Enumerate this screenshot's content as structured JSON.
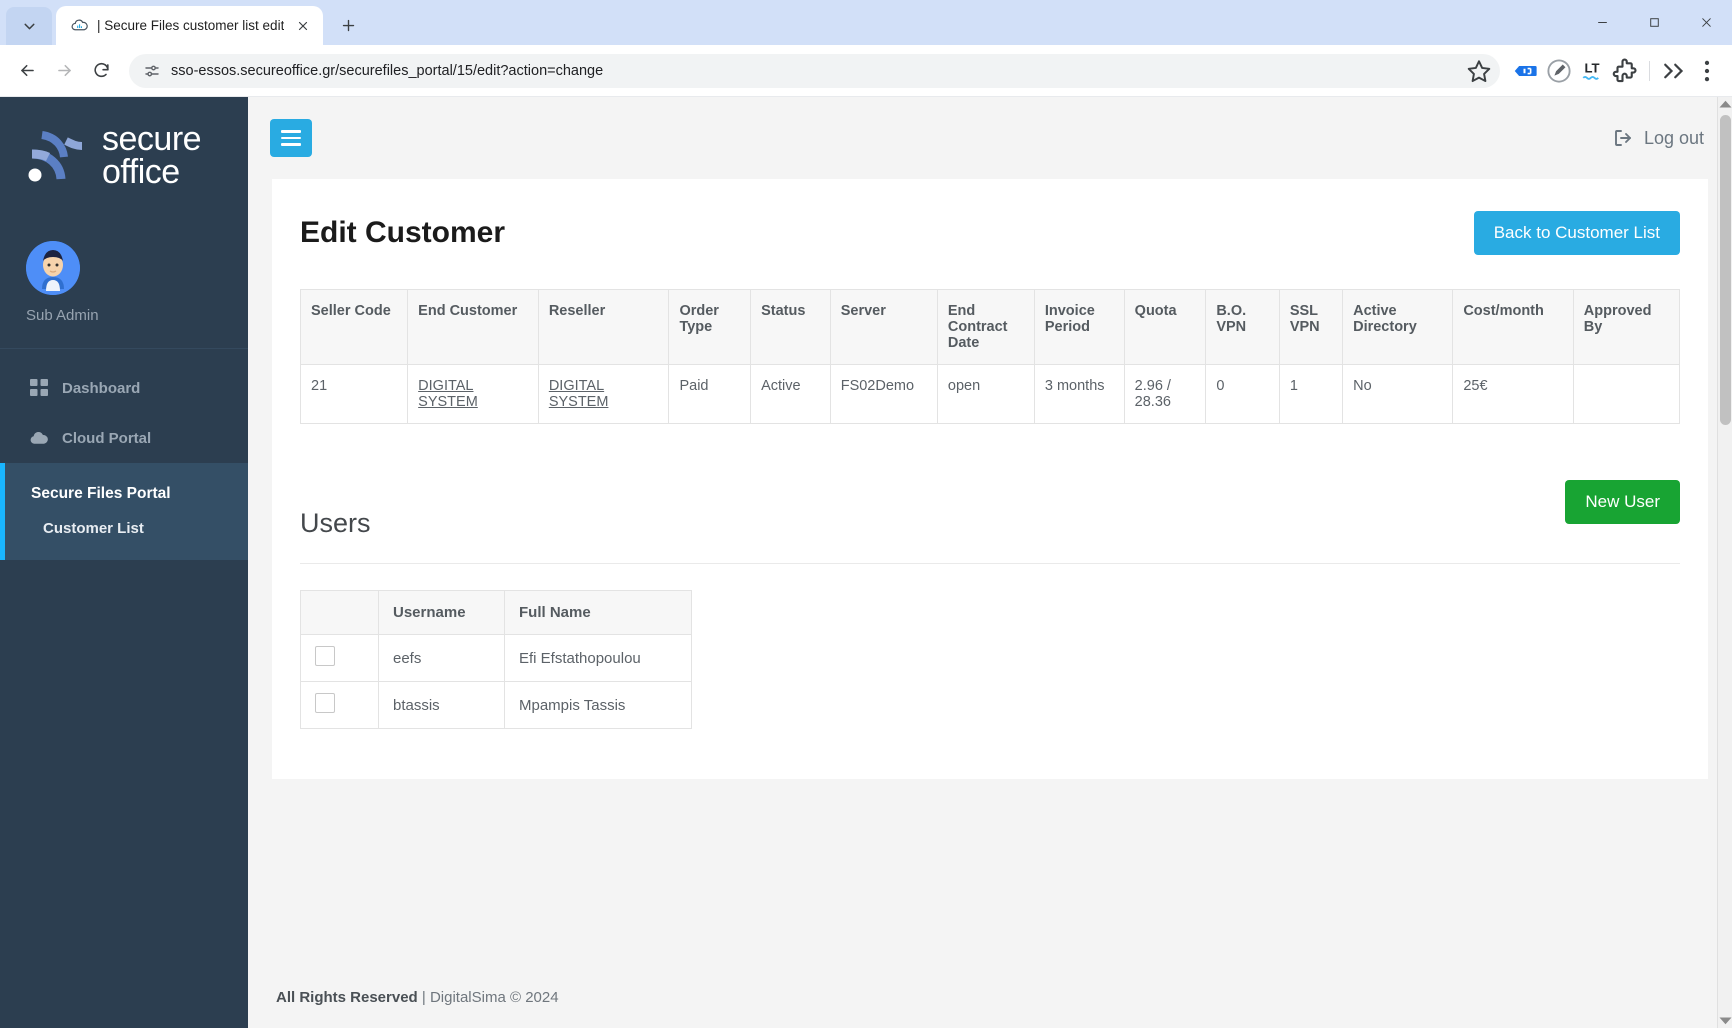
{
  "browser": {
    "tab": {
      "title": "| Secure Files customer list edit",
      "favicon": "cloud-chart-icon"
    },
    "new_tab_label": "+",
    "url": "sso-essos.secureoffice.gr/securefiles_portal/15/edit?action=change",
    "window_controls": [
      "minimize",
      "maximize",
      "close"
    ],
    "toolbar_icons": [
      "back-arrow",
      "forward-arrow",
      "reload",
      "site-info",
      "bookmark-star",
      "reading-list",
      "edit-pencil",
      "languagetool",
      "extensions-puzzle",
      "profile",
      "chrome-menu"
    ]
  },
  "sidebar": {
    "brand": {
      "line1": "secure",
      "line2": "office"
    },
    "user": {
      "name": "Sub Admin",
      "avatar": "user-avatar"
    },
    "items": [
      {
        "label": "Dashboard",
        "icon": "grid-icon"
      },
      {
        "label": "Cloud Portal",
        "icon": "cloud-icon"
      }
    ],
    "active_section": {
      "title": "Secure Files Portal",
      "sub": "Customer List"
    }
  },
  "topbar": {
    "menu_toggle": "hamburger-icon",
    "logout_label": "Log out",
    "logout_icon": "logout-icon"
  },
  "main": {
    "page_title": "Edit Customer",
    "back_button": "Back to Customer List",
    "customer_table": {
      "headers": [
        "Seller Code",
        "End Customer",
        "Reseller",
        "Order Type",
        "Status",
        "Server",
        "End Contract Date",
        "Invoice Period",
        "Quota",
        "B.O. VPN",
        "SSL VPN",
        "Active Directory",
        "Cost/month",
        "Approved By"
      ],
      "row": {
        "seller_code": "21",
        "end_customer": "DIGITAL SYSTEM",
        "reseller": "DIGITAL SYSTEM",
        "order_type": "Paid",
        "status": "Active",
        "server": "FS02Demo",
        "end_contract_date": "open",
        "invoice_period": "3 months",
        "quota": "2.96 / 28.36",
        "bo_vpn": "0",
        "ssl_vpn": "1",
        "active_directory": "No",
        "cost_month": "25€",
        "approved_by": ""
      }
    },
    "users_section": {
      "title": "Users",
      "new_user_button": "New User",
      "headers": [
        "",
        "Username",
        "Full Name"
      ],
      "rows": [
        {
          "username": "eefs",
          "full_name": "Efi Efstathopoulou"
        },
        {
          "username": "btassis",
          "full_name": "Mpampis Tassis"
        }
      ]
    }
  },
  "footer": {
    "strong": "All Rights Reserved",
    "rest": "| DigitalSima © 2024"
  },
  "colors": {
    "accent": "#29abe2",
    "success": "#18a433",
    "sidebar": "#2c3e50",
    "sidebar_active": "#344f66",
    "active_border": "#19b5fe"
  }
}
